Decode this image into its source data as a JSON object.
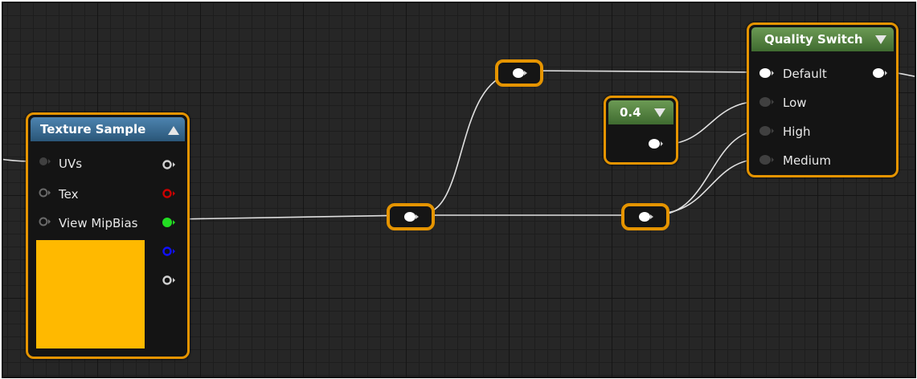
{
  "texture_sample": {
    "title": "Texture Sample",
    "inputs": [
      "UVs",
      "Tex",
      "View MipBias"
    ],
    "output_pin_colors": [
      "#d0d0d0",
      "#cc0000",
      "#22dd22",
      "#1010ff",
      "#d0d0d0"
    ],
    "preview_color": "#ffb900"
  },
  "constant_node": {
    "value": "0.4"
  },
  "quality_switch": {
    "title": "Quality Switch",
    "inputs": [
      "Default",
      "Low",
      "High",
      "Medium"
    ]
  },
  "colors": {
    "selection_outline": "#e59400",
    "background": "#262626",
    "wire": "#e0e0e0"
  },
  "icons": {
    "collapse": "triangle-up-icon",
    "expand": "triangle-down-icon",
    "pin": "pin-icon"
  }
}
